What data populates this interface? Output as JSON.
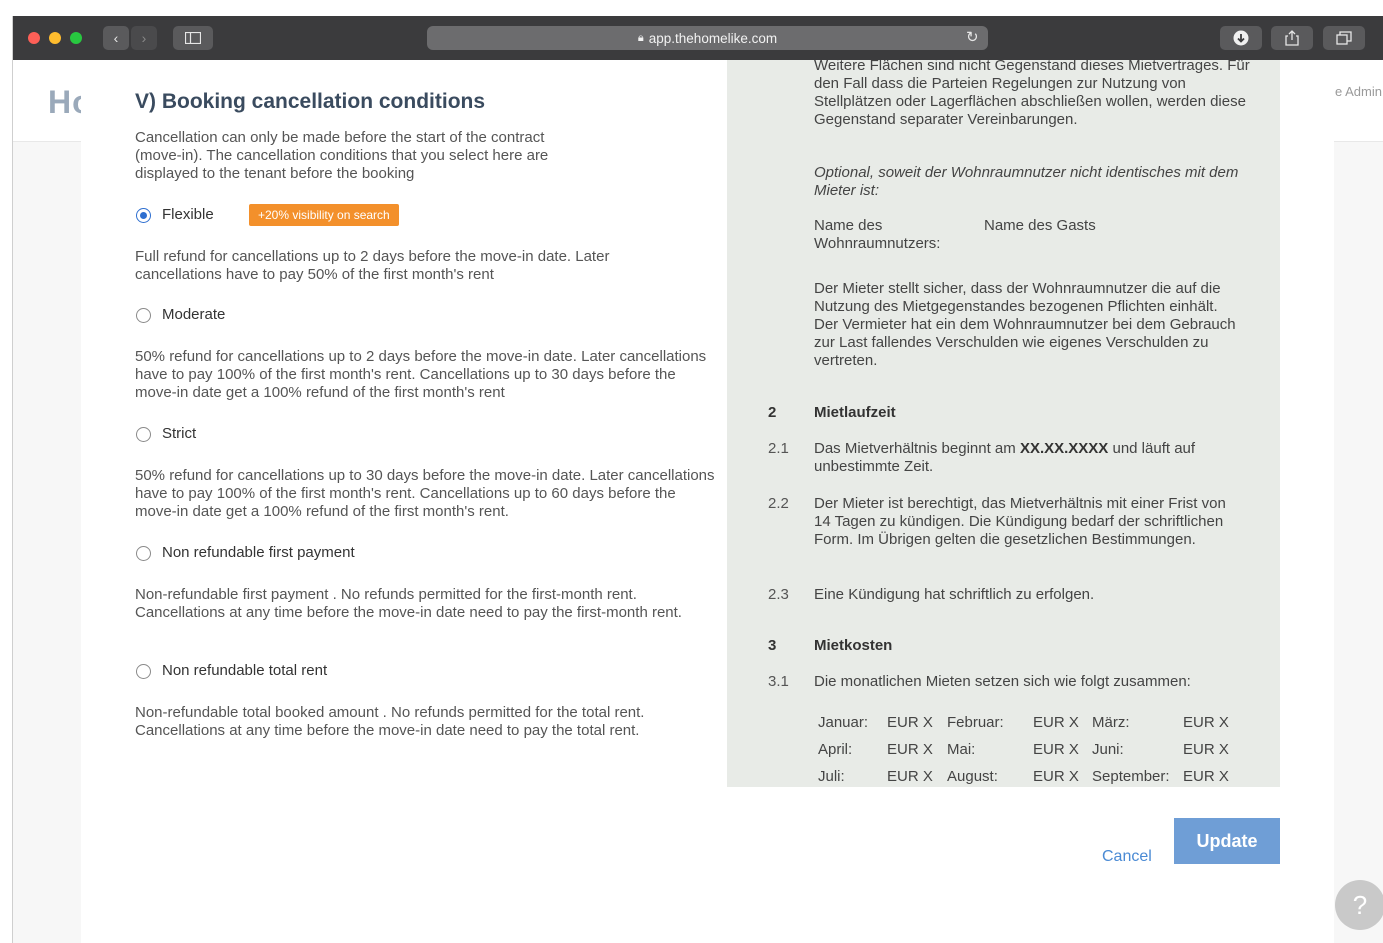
{
  "browser": {
    "url": "app.thehomelike.com",
    "colors": {
      "close": "#fd5f57",
      "minimize": "#febc2e",
      "maximize": "#28c840"
    }
  },
  "background_page": {
    "logo": "Ho",
    "admin_text": "e Admin"
  },
  "section": {
    "title": "V) Booking cancellation conditions",
    "intro": "Cancellation can only be made before the start of the contract (move-in). The cancellation conditions that you select here are displayed to the tenant before the booking",
    "options": [
      {
        "label": "Flexible",
        "selected": true,
        "badge": "+20% visibility on search",
        "description": "Full refund for cancellations up to 2 days before the move-in date. Later cancellations have to pay 50% of the first month's rent"
      },
      {
        "label": "Moderate",
        "selected": false,
        "description": "50% refund for cancellations up to 2 days before the move-in date. Later cancellations have to pay 100% of the first month's rent. Cancellations up to 30 days before the move-in date get a 100% refund of the first month's rent"
      },
      {
        "label": "Strict",
        "selected": false,
        "description": "50% refund for cancellations up to 30 days before the move-in date. Later cancellations have to pay 100% of the first month's rent. Cancellations up to 60 days before the move-in date get a 100% refund of the first month's rent."
      },
      {
        "label": "Non refundable first payment",
        "selected": false,
        "description": "Non-refundable first payment . No refunds permitted for the first-month rent. Cancellations at any time before the move-in date need to pay the first-month rent."
      },
      {
        "label": "Non refundable total rent",
        "selected": false,
        "description": "Non-refundable total booked amount . No refunds permitted for the total rent. Cancellations at any time before the move-in date need to pay the total rent."
      }
    ]
  },
  "contract": {
    "para1": "Weitere Flächen sind nicht Gegenstand dieses Mietvertrages. Für den Fall dass die Parteien Regelungen zur Nutzung von Stellplätzen oder Lagerflächen abschließen wollen, werden diese Gegenstand separater Vereinbarungen.",
    "optional": "Optional, soweit der Wohnraumnutzer nicht identisches mit dem Mieter ist:",
    "name_label": "Name des Wohnraumnutzers:",
    "name_value": "Name des Gasts",
    "para2": "Der Mieter stellt sicher, dass der Wohnraumnutzer die auf die Nutzung des Mietgegenstandes bezogenen Pflichten einhält. Der Vermieter hat ein dem Wohnraumnutzer bei dem Gebrauch zur Last fallendes Verschulden wie eigenes Verschulden zu vertreten.",
    "s2_num": "2",
    "s2_title": "Mietlaufzeit",
    "s21_num": "2.1",
    "s21_pre": "Das Mietverhältnis beginnt am ",
    "s21_bold": "XX.XX.XXXX",
    "s21_post": " und läuft auf unbestimmte Zeit.",
    "s22_num": "2.2",
    "s22": "Der Mieter ist berechtigt, das Mietverhältnis mit einer Frist von 14 Tagen zu kündigen. Die Kündigung bedarf der schriftlichen Form. Im Übrigen gelten die gesetzlichen Bestimmungen.",
    "s23_num": "2.3",
    "s23": "Eine Kündigung hat schriftlich zu erfolgen.",
    "s3_num": "3",
    "s3_title": "Mietkosten",
    "s31_num": "3.1",
    "s31": "Die monatlichen Mieten setzen sich wie folgt zusammen:",
    "months": [
      [
        "Januar:",
        "EUR X",
        "Februar:",
        "EUR X",
        "März:",
        "EUR X"
      ],
      [
        "April:",
        "EUR X",
        "Mai:",
        "EUR X",
        "Juni:",
        "EUR X"
      ],
      [
        "Juli:",
        "EUR X",
        "August:",
        "EUR X",
        "September:",
        "EUR X"
      ]
    ]
  },
  "actions": {
    "cancel": "Cancel",
    "update": "Update",
    "help": "?"
  }
}
